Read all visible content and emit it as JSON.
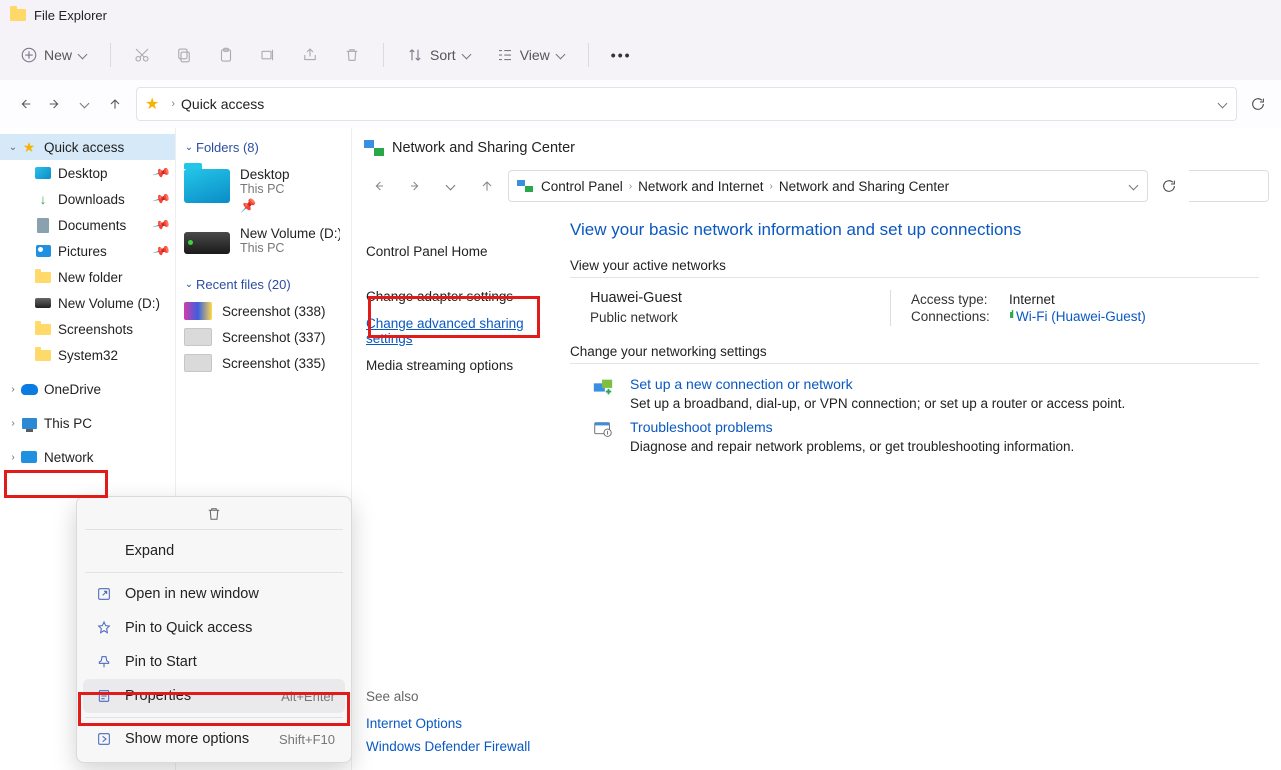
{
  "window": {
    "title": "File Explorer"
  },
  "toolbar": {
    "new": "New",
    "sort": "Sort",
    "view": "View",
    "more": "..."
  },
  "address": {
    "location": "Quick access"
  },
  "tree": {
    "quick_access": "Quick access",
    "items": [
      {
        "label": "Desktop",
        "icon": "desk",
        "pinned": true
      },
      {
        "label": "Downloads",
        "icon": "dl",
        "pinned": true
      },
      {
        "label": "Documents",
        "icon": "doc",
        "pinned": true
      },
      {
        "label": "Pictures",
        "icon": "pic",
        "pinned": true
      },
      {
        "label": "New folder",
        "icon": "folder",
        "pinned": false
      },
      {
        "label": "New Volume (D:)",
        "icon": "vol",
        "pinned": false
      },
      {
        "label": "Screenshots",
        "icon": "folder",
        "pinned": false
      },
      {
        "label": "System32",
        "icon": "folder",
        "pinned": false
      }
    ],
    "onedrive": "OneDrive",
    "thispc": "This PC",
    "network": "Network"
  },
  "content": {
    "folders_header": "Folders (8)",
    "folders": [
      {
        "title": "Desktop",
        "sub": "This PC",
        "pin": true,
        "kind": "folder"
      },
      {
        "title": "New Volume (D:)",
        "sub": "This PC",
        "pin": false,
        "kind": "drive"
      }
    ],
    "recent_header": "Recent files (20)",
    "recent": [
      {
        "title": "Screenshot (338)",
        "color": true
      },
      {
        "title": "Screenshot (337)",
        "color": false
      },
      {
        "title": "Screenshot (335)",
        "color": false
      }
    ]
  },
  "nsc": {
    "title": "Network and Sharing Center",
    "crumbs": [
      "Control Panel",
      "Network and Internet",
      "Network and Sharing Center"
    ],
    "left": {
      "home": "Control Panel Home",
      "adapter": "Change adapter settings",
      "advanced": "Change advanced sharing settings",
      "media": "Media streaming options"
    },
    "heading": "View your basic network information and set up connections",
    "active_hdr": "View your active networks",
    "net": {
      "name": "Huawei-Guest",
      "type": "Public network",
      "access_k": "Access type:",
      "access_v": "Internet",
      "conn_k": "Connections:",
      "conn_v": "Wi-Fi (Huawei-Guest)"
    },
    "change_hdr": "Change your networking settings",
    "setup": {
      "t": "Set up a new connection or network",
      "d": "Set up a broadband, dial-up, or VPN connection; or set up a router or access point."
    },
    "trouble": {
      "t": "Troubleshoot problems",
      "d": "Diagnose and repair network problems, or get troubleshooting information."
    },
    "seealso": {
      "h": "See also",
      "internet": "Internet Options",
      "firewall": "Windows Defender Firewall"
    }
  },
  "ctx": {
    "expand": "Expand",
    "open_new": "Open in new window",
    "pin_qa": "Pin to Quick access",
    "pin_start": "Pin to Start",
    "properties": "Properties",
    "properties_sc": "Alt+Enter",
    "more": "Show more options",
    "more_sc": "Shift+F10"
  }
}
